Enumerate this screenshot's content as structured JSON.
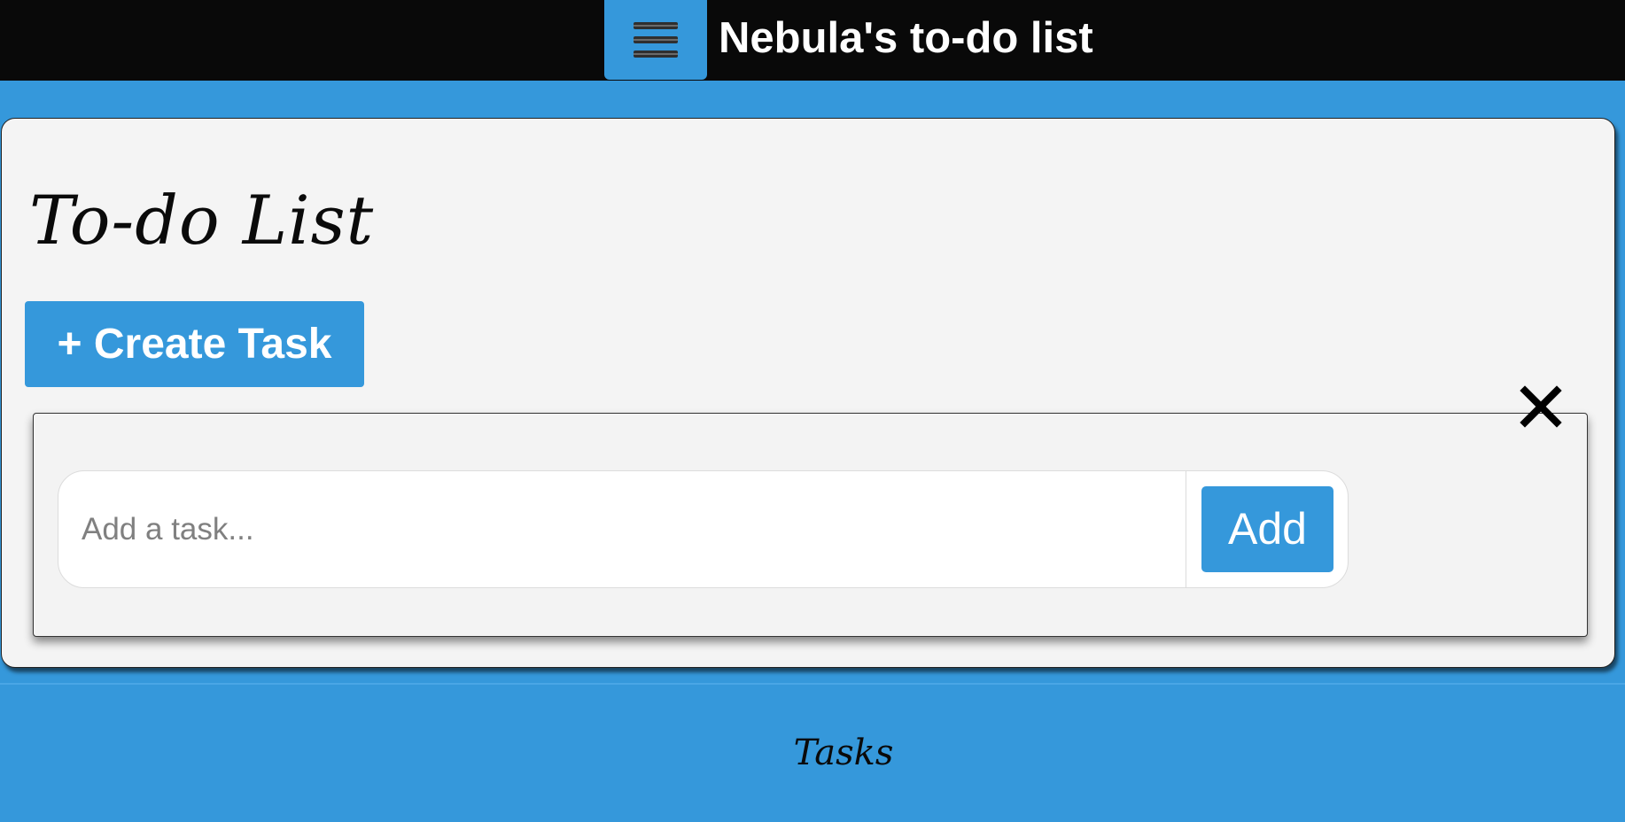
{
  "header": {
    "menu_icon": "hamburger-menu-icon",
    "title": "Nebula's to-do list"
  },
  "card": {
    "title": "To-do List",
    "create_button_label": "+ Create Task"
  },
  "modal": {
    "close_icon": "close-icon",
    "input_placeholder": "Add a task...",
    "input_value": "",
    "add_button_label": "Add"
  },
  "footer": {
    "label": "Tasks"
  },
  "colors": {
    "accent": "#3598db",
    "topbar": "#090909",
    "card_background": "#f4f4f4",
    "modal_background": "#f3f3f3"
  }
}
